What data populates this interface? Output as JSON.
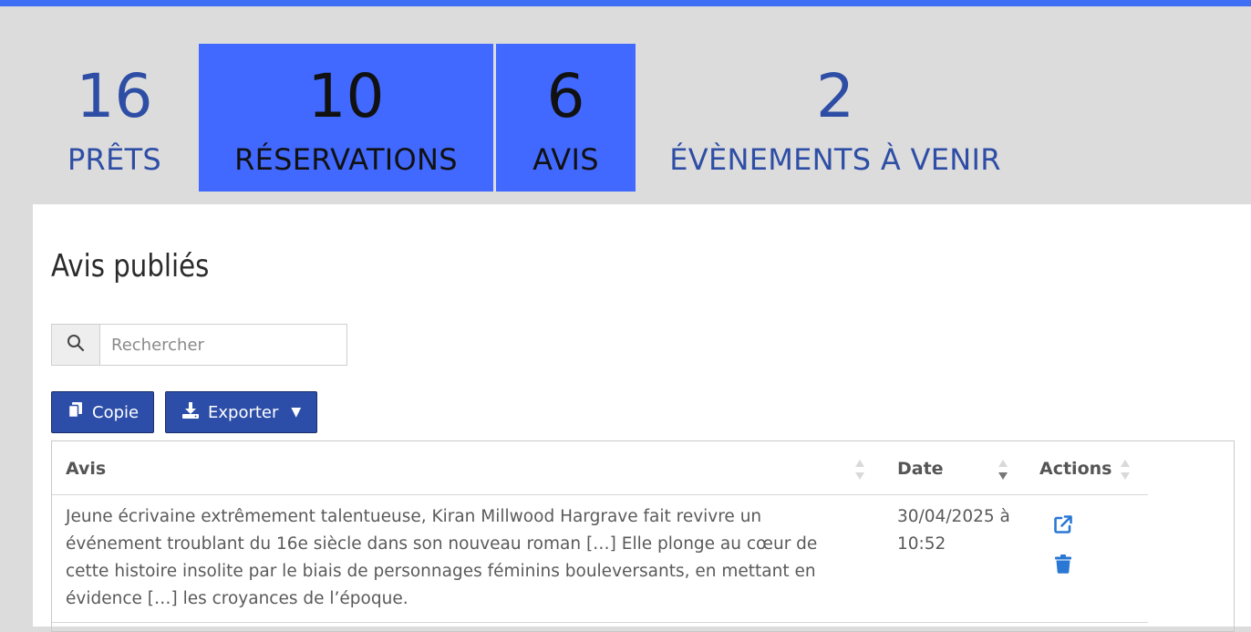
{
  "stats": [
    {
      "value": "16",
      "label": "PRÊTS"
    },
    {
      "value": "10",
      "label": "RÉSERVATIONS"
    },
    {
      "value": "6",
      "label": "AVIS"
    },
    {
      "value": "2",
      "label": "ÉVÈNEMENTS À VENIR"
    }
  ],
  "panel": {
    "title": "Avis publiés",
    "search": {
      "placeholder": "Rechercher",
      "value": ""
    },
    "buttons": {
      "copy": "Copie",
      "export": "Exporter"
    }
  },
  "table": {
    "columns": [
      "Avis",
      "Date",
      "Actions"
    ],
    "rows": [
      {
        "avis_lines": [
          "Jeune écrivaine extrêmement talentueuse, Kiran Millwood Hargrave fait revivre un",
          "événement troublant du 16e siècle dans son nouveau roman […] Elle plonge au cœur de",
          "cette histoire insolite par le biais de personnages féminins bouleversants, en mettant en",
          "évidence […] les croyances de l’époque."
        ],
        "date_lines": [
          "30/04/2025 à",
          "10:52"
        ]
      }
    ]
  },
  "colors": {
    "accent": "#4169ff",
    "top_bar": "#3f6ff5",
    "button": "#2c4ea8",
    "stat_text": "#2e4ea6",
    "action_icon": "#2a78d4"
  },
  "icons": [
    "search-icon",
    "copy-icon",
    "download-icon",
    "external-link-icon",
    "trash-icon",
    "sort-icon"
  ]
}
